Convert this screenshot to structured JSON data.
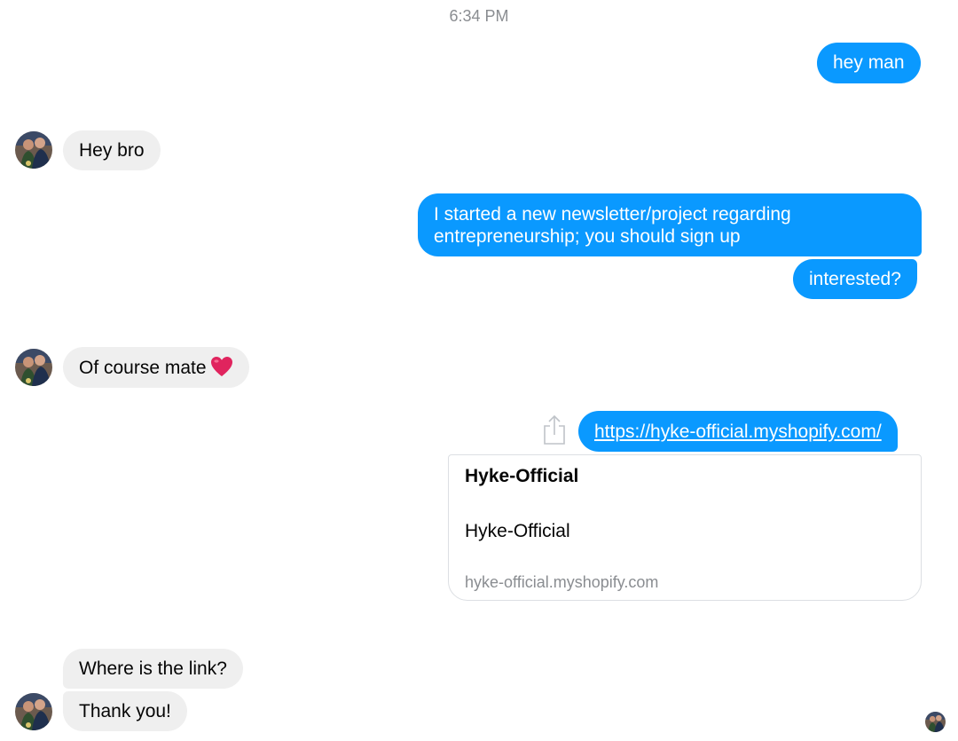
{
  "conversation": {
    "timestamp": "6:34 PM",
    "messages": {
      "m1": "hey man",
      "m2": "Hey bro",
      "m3_line1": "I started a new newsletter/project regarding",
      "m3_line2": "entrepreneurship; you should sign up",
      "m4": "interested?",
      "m5": "Of course mate",
      "m6": "https://hyke-official.myshopify.com/",
      "m7": "Where is the link?",
      "m8": "Thank you!"
    },
    "link_preview": {
      "title": "Hyke-Official",
      "description": "Hyke-Official",
      "domain": "hyke-official.myshopify.com"
    }
  },
  "colors": {
    "outgoing_bubble": "#0a99ff",
    "incoming_bubble": "#efefef",
    "heart": "#e0245e"
  },
  "icons": {
    "share": "share-icon",
    "heart": "heart-emoji-icon",
    "avatar": "contact-avatar",
    "read_receipt": "read-receipt-avatar"
  }
}
